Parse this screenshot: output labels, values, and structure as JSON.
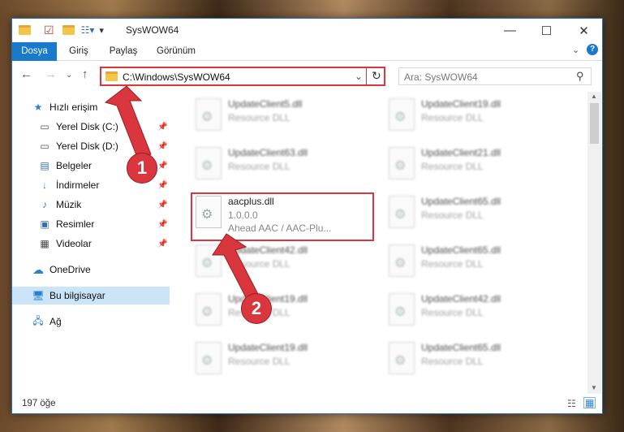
{
  "window": {
    "title": "SysWOW64"
  },
  "ribbon": {
    "tabs": [
      "Dosya",
      "Giriş",
      "Paylaş",
      "Görünüm"
    ]
  },
  "address": {
    "path": "C:\\Windows\\SysWOW64"
  },
  "search": {
    "placeholder": "Ara: SysWOW64"
  },
  "sidebar": {
    "items": [
      {
        "label": "Hızlı erişim",
        "icon": "star-icon"
      },
      {
        "label": "Yerel Disk (C:)",
        "icon": "drive-icon"
      },
      {
        "label": "Yerel Disk (D:)",
        "icon": "drive-icon"
      },
      {
        "label": "Belgeler",
        "icon": "document-icon"
      },
      {
        "label": "İndirmeler",
        "icon": "download-icon"
      },
      {
        "label": "Müzik",
        "icon": "music-icon"
      },
      {
        "label": "Resimler",
        "icon": "pictures-icon"
      },
      {
        "label": "Videolar",
        "icon": "video-icon"
      },
      {
        "label": "OneDrive",
        "icon": "cloud-icon"
      },
      {
        "label": "Bu bilgisayar",
        "icon": "computer-icon"
      },
      {
        "label": "Ağ",
        "icon": "network-icon"
      }
    ]
  },
  "files": {
    "left": [
      {
        "name": "UpdateClient5.dll",
        "type": "Resource DLL"
      },
      {
        "name": "UpdateClient63.dll",
        "type": "Resource DLL"
      },
      {
        "name": "aacplus.dll",
        "version": "1.0.0.0",
        "desc": "Ahead AAC / AAC-Plu..."
      },
      {
        "name": "UpdateClient42.dll",
        "type": "Resource DLL"
      },
      {
        "name": "UpdateClient19.dll",
        "type": "Resource DLL"
      },
      {
        "name": "UpdateClient19.dll",
        "type": "Resource DLL"
      }
    ],
    "right": [
      {
        "name": "UpdateClient19.dll",
        "type": "Resource DLL"
      },
      {
        "name": "UpdateClient21.dll",
        "type": "Resource DLL"
      },
      {
        "name": "UpdateClient65.dll",
        "type": "Resource DLL"
      },
      {
        "name": "UpdateClient65.dll",
        "type": "Resource DLL"
      },
      {
        "name": "UpdateClient42.dll",
        "type": "Resource DLL"
      },
      {
        "name": "UpdateClient65.dll",
        "type": "Resource DLL"
      }
    ]
  },
  "status": {
    "count": "197 öğe"
  },
  "markers": {
    "one": "1",
    "two": "2"
  },
  "colors": {
    "accent": "#1979ca",
    "highlight": "#d9363e"
  }
}
